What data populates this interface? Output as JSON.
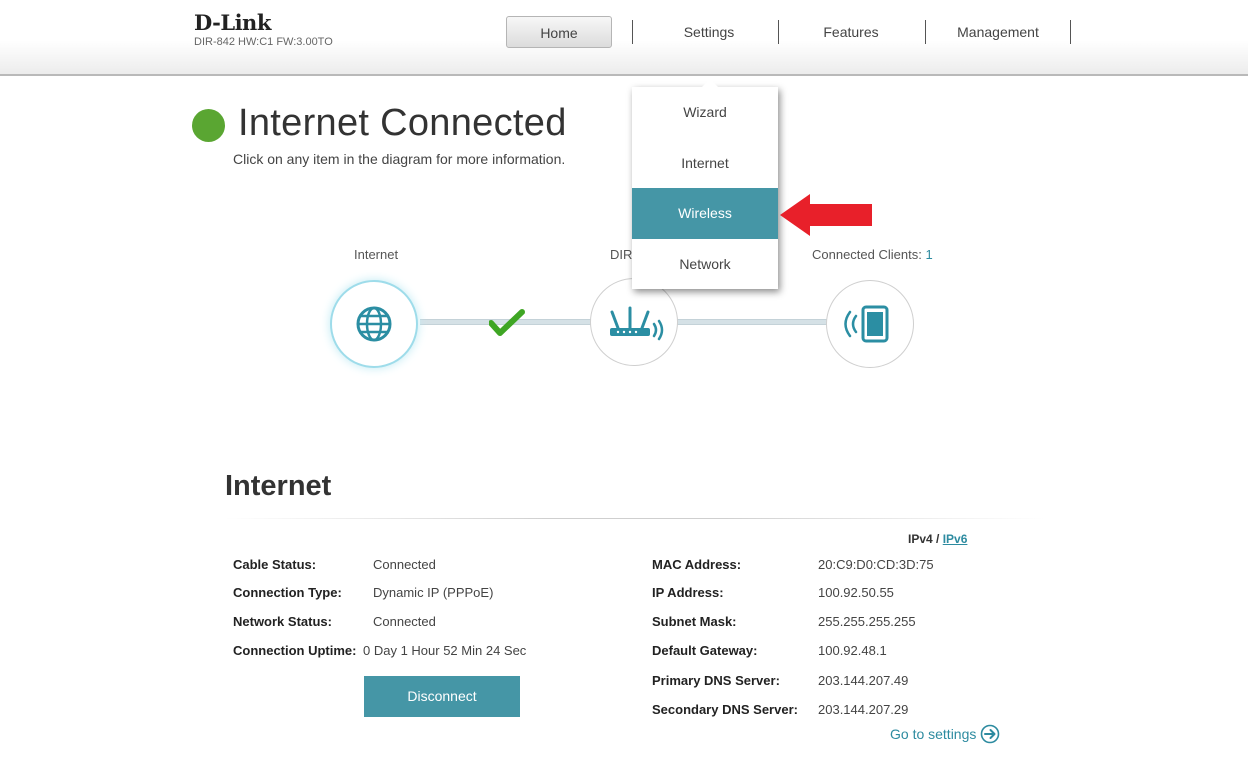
{
  "header": {
    "brand": "D-Link",
    "model": "DIR-842 HW:C1 FW:3.00TO",
    "nav": {
      "home": "Home",
      "settings": "Settings",
      "features": "Features",
      "management": "Management"
    }
  },
  "settings_menu": {
    "items": [
      "Wizard",
      "Internet",
      "Wireless",
      "Network"
    ],
    "active": "Wireless"
  },
  "status": {
    "title": "Internet Connected",
    "hint": "Click on any item in the diagram for more information.",
    "indicator_color": "#5aa632"
  },
  "diagram": {
    "internet_label": "Internet",
    "router_label": "DIR",
    "clients_label": "Connected Clients: ",
    "clients_count": "1"
  },
  "internet": {
    "title": "Internet",
    "ipv4": "IPv4",
    "ipv_sep": "/",
    "ipv6": "IPv6",
    "left": [
      {
        "key": "Cable Status:",
        "value": "Connected"
      },
      {
        "key": "Connection Type:",
        "value": "Dynamic IP (PPPoE)"
      },
      {
        "key": "Network Status:",
        "value": "Connected"
      },
      {
        "key": "Connection Uptime:",
        "value": "0 Day 1 Hour 52 Min 24 Sec"
      }
    ],
    "right": [
      {
        "key": "MAC Address:",
        "value": "20:C9:D0:CD:3D:75"
      },
      {
        "key": "IP Address:",
        "value": "100.92.50.55"
      },
      {
        "key": "Subnet Mask:",
        "value": "255.255.255.255"
      },
      {
        "key": "Default Gateway:",
        "value": "100.92.48.1"
      },
      {
        "key": "Primary DNS Server:",
        "value": "203.144.207.49"
      },
      {
        "key": "Secondary DNS Server:",
        "value": "203.144.207.29"
      }
    ],
    "disconnect": "Disconnect",
    "goto_settings": "Go to settings"
  },
  "colors": {
    "accent": "#4596a6",
    "link": "#2d8ba0",
    "annotation_arrow": "#e8202a"
  }
}
